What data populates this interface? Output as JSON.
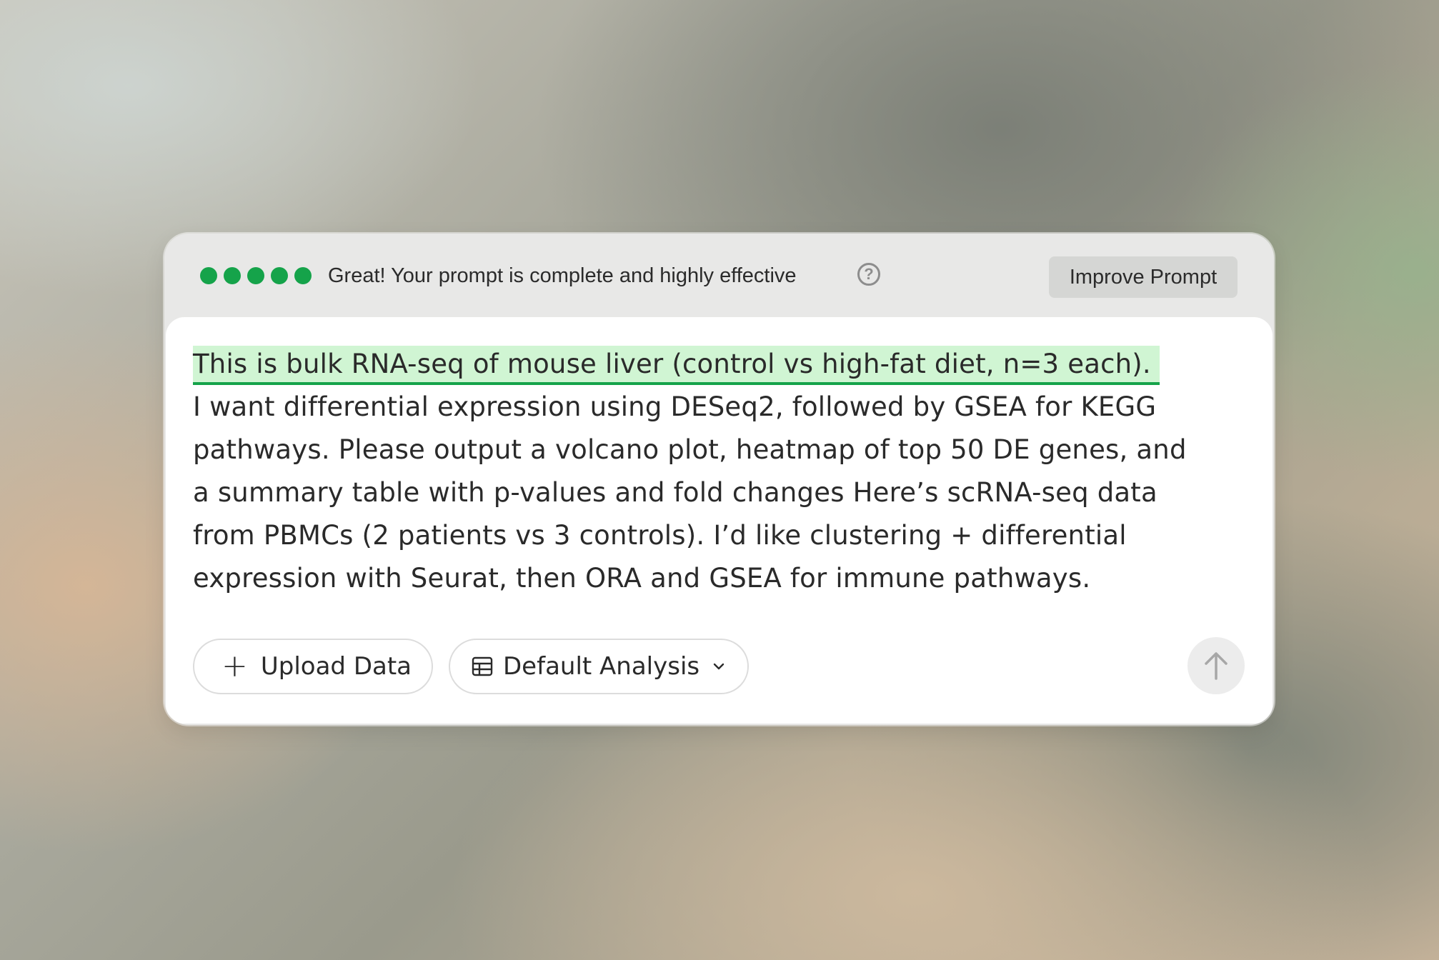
{
  "header": {
    "rating_dots": 5,
    "rating_color": "#15a34a",
    "status_text": "Great! Your prompt is complete and highly effective",
    "help_icon_glyph": "?",
    "improve_label": "Improve Prompt"
  },
  "prompt": {
    "highlighted_line": "This is bulk RNA-seq of mouse liver (control vs high-fat diet, n=3 each).",
    "lines": [
      "I want differential expression using DESeq2, followed by GSEA for KEGG",
      "pathways. Please output a volcano plot, heatmap of top 50 DE genes, and",
      "a summary table with p-values and fold changes Here’s scRNA-seq data",
      "from PBMCs (2 patients vs 3 controls). I’d like clustering + differential",
      "expression with Seurat, then ORA and GSEA for immune pathways."
    ],
    "highlight_color": "#d0f5d3"
  },
  "toolbar": {
    "upload_icon_glyph": "+",
    "upload_label": "Upload Data",
    "analysis_label": "Default Analysis",
    "send_icon": "arrow-up-icon"
  }
}
